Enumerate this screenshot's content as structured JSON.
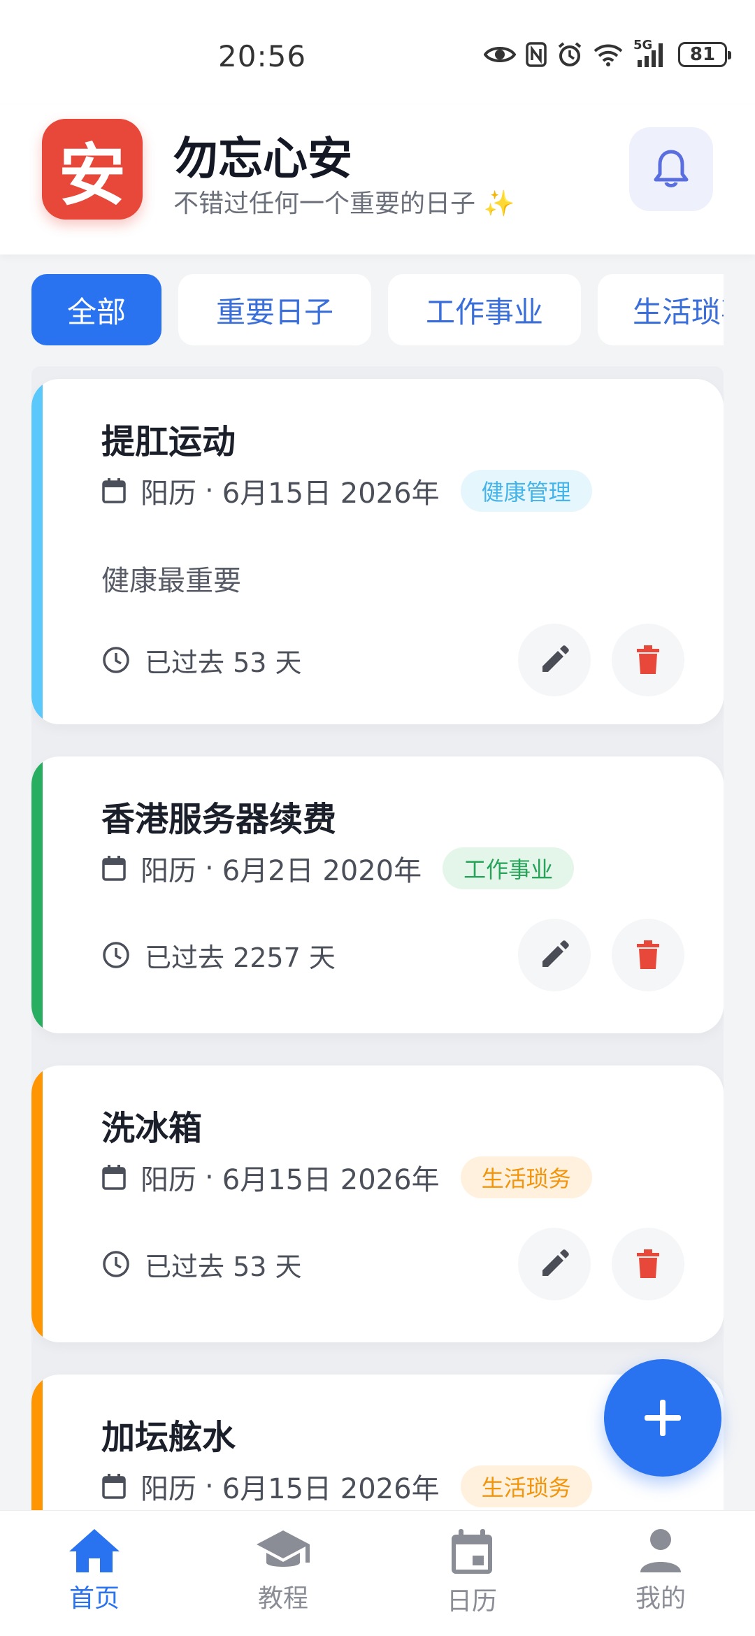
{
  "status_bar": {
    "time": "20:56",
    "network_label": "5G",
    "battery_level": "81"
  },
  "header": {
    "logo_char": "安",
    "title": "勿忘心安",
    "subtitle": "不错过任何一个重要的日子 ✨",
    "bell_icon": "bell-icon"
  },
  "tabs": [
    {
      "label": "全部",
      "active": true
    },
    {
      "label": "重要日子",
      "active": false
    },
    {
      "label": "工作事业",
      "active": false
    },
    {
      "label": "生活琐事",
      "active": false
    }
  ],
  "events": [
    {
      "title": "提肛运动",
      "calendar": "阳历",
      "date": "6月15日 2026年",
      "tag": "健康管理",
      "note": "健康最重要",
      "elapsed": "已过去 53 天",
      "accent": "#5ac8fa",
      "tag_bg": "#e6f6fd",
      "tag_color": "#45b4e8"
    },
    {
      "title": "香港服务器续费",
      "calendar": "阳历",
      "date": "6月2日 2020年",
      "tag": "工作事业",
      "note": "",
      "elapsed": "已过去 2257 天",
      "accent": "#27ae60",
      "tag_bg": "#e4f6ea",
      "tag_color": "#27a35a"
    },
    {
      "title": "洗冰箱",
      "calendar": "阳历",
      "date": "6月15日 2026年",
      "tag": "生活琐务",
      "note": "",
      "elapsed": "已过去 53 天",
      "accent": "#ff9500",
      "tag_bg": "#fff1de",
      "tag_color": "#f0950c"
    },
    {
      "title": "加坛舷水",
      "calendar": "阳历",
      "date": "6月15日 2026年",
      "tag": "生活琐务",
      "note": "",
      "elapsed": "",
      "accent": "#ff9500",
      "tag_bg": "#fff1de",
      "tag_color": "#f0950c"
    }
  ],
  "fab": {
    "icon": "plus-icon"
  },
  "bottom_nav": [
    {
      "label": "首页",
      "icon": "home-icon",
      "active": true
    },
    {
      "label": "教程",
      "icon": "graduation-cap-icon",
      "active": false
    },
    {
      "label": "日历",
      "icon": "calendar-icon",
      "active": false
    },
    {
      "label": "我的",
      "icon": "person-icon",
      "active": false
    }
  ],
  "colors": {
    "primary": "#2a73f0",
    "logo_red": "#e8483a",
    "delete_red": "#e8483a"
  }
}
